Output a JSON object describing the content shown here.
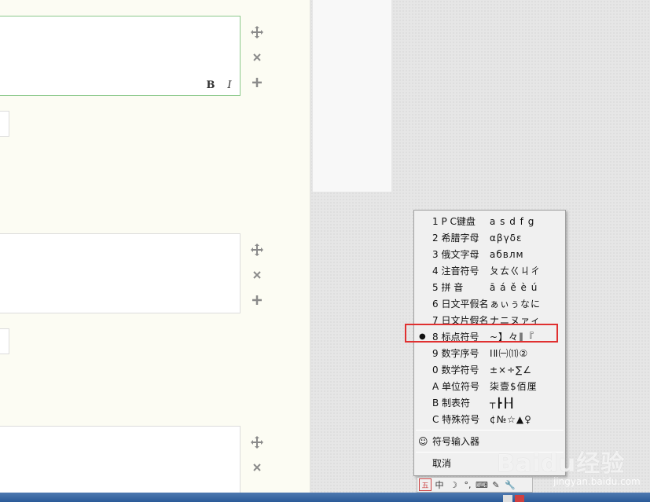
{
  "editor": {
    "bold_label": "B",
    "italic_label": "I"
  },
  "ime_menu": {
    "items": [
      {
        "label": "1 P C键盘",
        "sample": "a s d f g",
        "selected": false
      },
      {
        "label": "2 希腊字母",
        "sample": "αβγδε",
        "selected": false
      },
      {
        "label": "3 俄文字母",
        "sample": "абвлм",
        "selected": false
      },
      {
        "label": "4 注音符号",
        "sample": "ㄆㄊㄍㄐㄔ",
        "selected": false
      },
      {
        "label": "5 拼    音",
        "sample": "ā á ě è ú",
        "selected": false
      },
      {
        "label": "6 日文平假名",
        "sample": "ぁぃぅなに",
        "selected": false
      },
      {
        "label": "7 日文片假名",
        "sample": "ナニヌァィ",
        "selected": false
      },
      {
        "label": "8 标点符号",
        "sample": "~】々‖『",
        "selected": true
      },
      {
        "label": "9 数字序号",
        "sample": "ⅠⅡ㈠⑾②",
        "selected": false
      },
      {
        "label": "0 数学符号",
        "sample": "±×÷∑∠",
        "selected": false
      },
      {
        "label": "A 单位符号",
        "sample": "柒壹$佰厘",
        "selected": false
      },
      {
        "label": "B 制表符",
        "sample": "┬┣┠┨",
        "selected": false
      },
      {
        "label": "C 特殊符号",
        "sample": "¢№☆▲♀",
        "selected": false
      }
    ],
    "symbol_input": "符号输入器",
    "cancel": "取消",
    "selected_bullet": "●",
    "smiley": "☺"
  },
  "ime_toolbar": {
    "wubi": "五",
    "chinese": "中",
    "moon": "☽",
    "punct": "°,",
    "keyboard": "⌨",
    "tools": "✎",
    "settings": "🔧"
  },
  "watermark": {
    "brand": "Baidu经验",
    "url": "jingyan.baidu.com"
  },
  "colors": {
    "highlight": "#e03030",
    "focus_border": "#8cc98c",
    "taskbar": "#2a5a98"
  }
}
